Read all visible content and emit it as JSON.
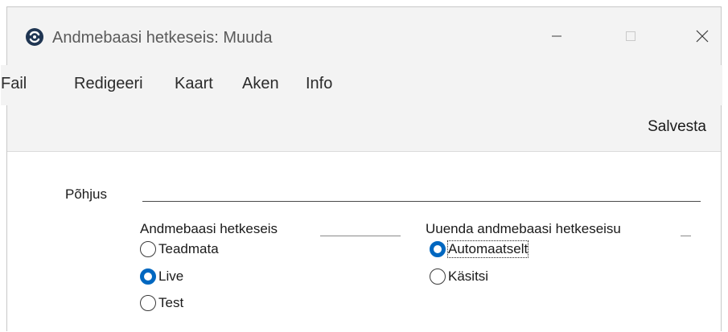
{
  "window": {
    "title": "Andmebaasi hetkeseis: Muuda",
    "icons": {
      "app": "app-logo-icon",
      "minimize": "minimize-icon",
      "maximize": "maximize-icon",
      "close": "close-icon"
    }
  },
  "menu": {
    "items": [
      {
        "label": "Fail"
      },
      {
        "label": "Redigeeri"
      },
      {
        "label": "Kaart"
      },
      {
        "label": "Aken"
      },
      {
        "label": "Info"
      }
    ]
  },
  "toolbar": {
    "save_label": "Salvesta"
  },
  "form": {
    "reason_label": "Põhjus",
    "reason_value": "",
    "db_state": {
      "heading": "Andmebaasi hetkeseis",
      "options": [
        {
          "label": "Teadmata",
          "checked": false
        },
        {
          "label": "Live",
          "checked": true
        },
        {
          "label": "Test",
          "checked": false
        }
      ]
    },
    "update": {
      "heading": "Uuenda andmebaasi hetkeseisu",
      "options": [
        {
          "label": "Automaatselt",
          "checked": true
        },
        {
          "label": "Käsitsi",
          "checked": false
        }
      ]
    }
  },
  "colors": {
    "accent": "#0067c0",
    "chrome": "#f3f3f3"
  }
}
